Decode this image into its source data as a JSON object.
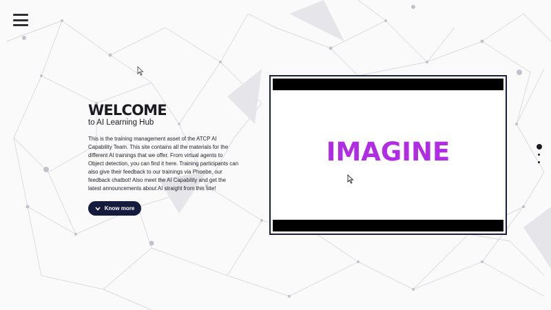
{
  "header": {
    "menu_icon": "hamburger-menu-icon"
  },
  "hero": {
    "title": "WELCOME",
    "subtitle": "to AI Learning Hub",
    "description": "This is the training management asset of the ATCP AI Capability Team. This site contains all the materials for the different AI trainings that we offer. From virtual agents to Object detection, you can find it here. Training participants can also give their feedback to our trainings via Phoebe, our feedback chatbot! Also meet the AI Capability and get the latest announcements about AI straight from this site!",
    "cta_label": "Know more",
    "cta_icon": "chevron-down-icon"
  },
  "video": {
    "text": "IMAGINE",
    "text_color": "#b02de4"
  },
  "slide_nav": {
    "count": 3,
    "active_index": 0
  },
  "colors": {
    "accent": "#151b3d",
    "heading": "#1b1b21",
    "background": "#fafafb",
    "network_lines": "#c8c8cf"
  }
}
